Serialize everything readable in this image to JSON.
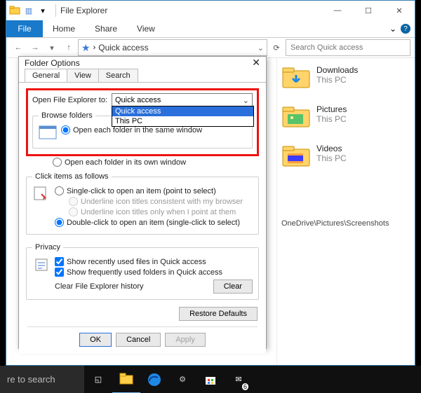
{
  "window": {
    "title": "File Explorer",
    "ribbon_file": "File",
    "tab_home": "Home",
    "tab_share": "Share",
    "tab_view": "View"
  },
  "address": {
    "sep": "›",
    "current": "Quick access",
    "search_placeholder": "Search Quick access"
  },
  "libraries": {
    "downloads": {
      "name": "Downloads",
      "loc": "This PC"
    },
    "pictures": {
      "name": "Pictures",
      "loc": "This PC"
    },
    "videos": {
      "name": "Videos",
      "loc": "This PC"
    }
  },
  "statuspath": "OneDrive\\Pictures\\Screenshots",
  "folder_options": {
    "title": "Folder Options",
    "tab_general": "General",
    "tab_view": "View",
    "tab_search": "Search",
    "open_label": "Open File Explorer to:",
    "combo_selected": "Quick access",
    "combo_options": {
      "0": "Quick access",
      "1": "This PC"
    },
    "browse_legend": "Browse folders",
    "browse_same": "Open each folder in the same window",
    "browse_own": "Open each folder in its own window",
    "click_legend": "Click items as follows",
    "click_single": "Single-click to open an item (point to select)",
    "click_uline1": "Underline icon titles consistent with my browser",
    "click_uline2": "Underline icon titles only when I point at them",
    "click_double": "Double-click to open an item (single-click to select)",
    "privacy_legend": "Privacy",
    "priv_recent": "Show recently used files in Quick access",
    "priv_freq": "Show frequently used folders in Quick access",
    "clear_label": "Clear File Explorer history",
    "clear_btn": "Clear",
    "restore_btn": "Restore Defaults",
    "ok": "OK",
    "cancel": "Cancel",
    "apply": "Apply"
  },
  "taskbar": {
    "search": "re to search"
  }
}
